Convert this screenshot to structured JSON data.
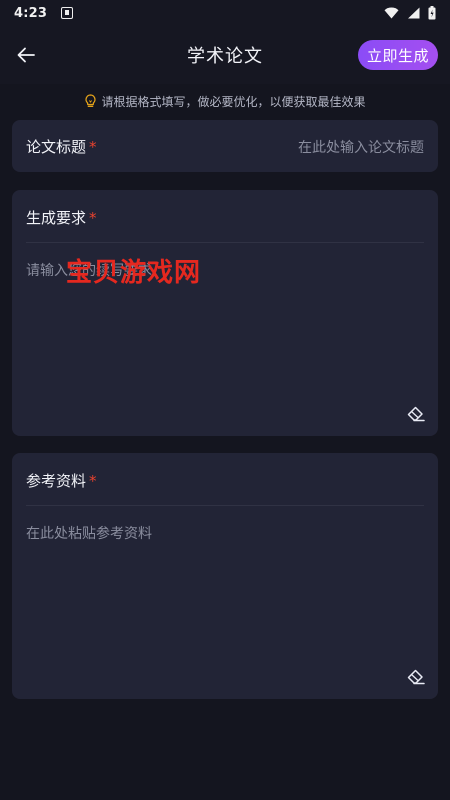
{
  "status_bar": {
    "time": "4:23"
  },
  "header": {
    "title": "学术论文",
    "generate_label": "立即生成"
  },
  "tip": {
    "text": "请根据格式填写，做必要优化，以便获取最佳效果"
  },
  "fields": {
    "title": {
      "label": "论文标题",
      "required_mark": "*",
      "placeholder": "在此处输入论文标题"
    },
    "requirements": {
      "label": "生成要求",
      "required_mark": "*",
      "placeholder": "请输入您的续写要求"
    },
    "references": {
      "label": "参考资料",
      "required_mark": "*",
      "placeholder": "在此处粘贴参考资料"
    }
  },
  "watermark": {
    "text": "宝贝游戏网"
  },
  "icons": [
    "notification-icon",
    "wifi-icon",
    "signal-icon",
    "battery-icon",
    "back-arrow-icon",
    "lightbulb-icon",
    "eraser-icon"
  ],
  "colors": {
    "background": "#14151f",
    "card": "#222436",
    "accent": "#9a4ef2",
    "required": "#e8432f"
  }
}
